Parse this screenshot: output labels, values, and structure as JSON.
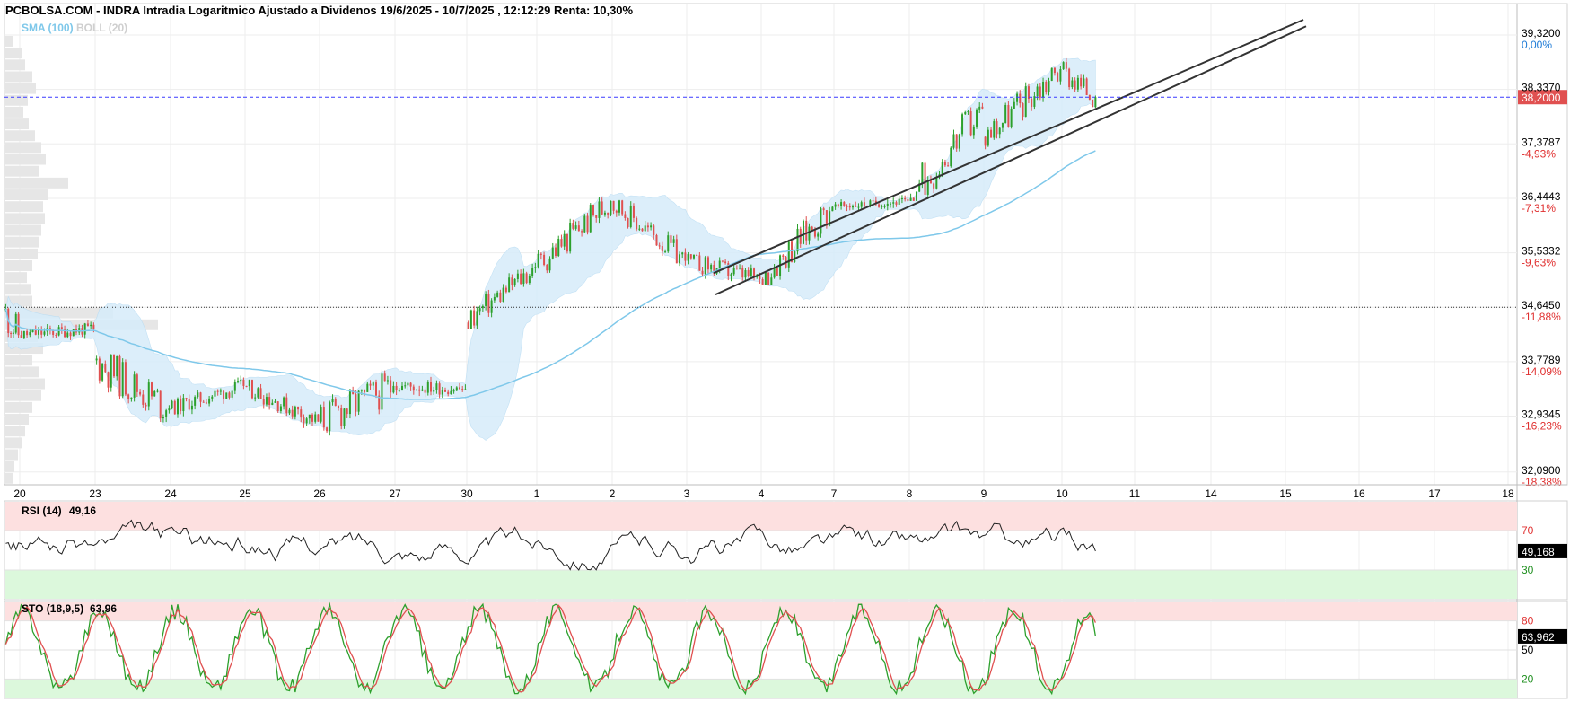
{
  "header": {
    "title": "PCBOLSA.COM - INDRA Intradia Logaritmico Ajustado a Dividenos 19/6/2025 - 10/7/2025 , 12:12:29 Renta: 10,30%",
    "sma_label": "SMA (100)",
    "boll_label": "BOLL (20)"
  },
  "colors": {
    "up": "#2ca02c",
    "down": "#e05050",
    "sma": "#7fc8ea",
    "boll_fill": "#d6ecfa",
    "trendline": "#333333",
    "price_line": "#3a3aff",
    "overbought_zone": "#fde0e0",
    "oversold_zone": "#dcf8dc",
    "rsi_line": "#222222",
    "sto_k": "#2ca02c",
    "sto_d": "#e05050",
    "pct_positive": "#1e7bd6",
    "pct_negative": "#e03030",
    "last_price_bg": "#e05050",
    "indicator_value_bg": "#000000",
    "volume_profile": "#e6e6e6"
  },
  "chart_data": [
    {
      "type": "candlestick",
      "title": "PCBOLSA.COM - INDRA Intradia Logaritmico Ajustado a Dividenos 19/6/2025 - 10/7/2025 , 12:12:29 Renta: 10,30%",
      "scale": "log",
      "ylim": [
        31.9,
        39.6
      ],
      "y_ticks": [
        {
          "value": "39,3200",
          "pct": "0,00%"
        },
        {
          "value": "38,3370",
          "pct": ""
        },
        {
          "value": "37,3787",
          "pct": "-4,93%"
        },
        {
          "value": "36,4443",
          "pct": "-7,31%"
        },
        {
          "value": "35,5332",
          "pct": "-9,63%"
        },
        {
          "value": "34,6450",
          "pct": "-11,88%"
        },
        {
          "value": "33,7789",
          "pct": "-14,09%"
        },
        {
          "value": "32,9345",
          "pct": "-16,23%"
        },
        {
          "value": "32,0900",
          "pct": "-18,38%"
        }
      ],
      "x_ticks": [
        "20",
        "23",
        "24",
        "25",
        "26",
        "27",
        "30",
        "1",
        "2",
        "3",
        "4",
        "7",
        "8",
        "9",
        "10",
        "11",
        "14",
        "15",
        "16",
        "17",
        "18"
      ],
      "last_price": "38,2000",
      "reference_level": 34.645,
      "indicators": [
        "SMA (100)",
        "BOLL (20)"
      ],
      "closes_by_session": [
        {
          "day": "19",
          "open": 34.6,
          "high": 34.7,
          "low": 33.0,
          "close": 34.2
        },
        {
          "day": "20",
          "open": 34.2,
          "high": 34.55,
          "low": 34.0,
          "close": 34.3
        },
        {
          "day": "23",
          "open": 33.8,
          "high": 33.9,
          "low": 32.15,
          "close": 33.05
        },
        {
          "day": "24",
          "open": 33.05,
          "high": 33.6,
          "low": 32.9,
          "close": 33.4
        },
        {
          "day": "25",
          "open": 33.4,
          "high": 33.5,
          "low": 32.7,
          "close": 32.85
        },
        {
          "day": "26",
          "open": 32.85,
          "high": 33.7,
          "low": 32.1,
          "close": 33.4
        },
        {
          "day": "27",
          "open": 33.4,
          "high": 33.7,
          "low": 33.1,
          "close": 33.35
        },
        {
          "day": "30",
          "open": 34.4,
          "high": 35.5,
          "low": 34.3,
          "close": 35.3
        },
        {
          "day": "1",
          "open": 35.3,
          "high": 36.7,
          "low": 35.2,
          "close": 36.4
        },
        {
          "day": "2",
          "open": 36.4,
          "high": 36.5,
          "low": 35.3,
          "close": 35.4
        },
        {
          "day": "3",
          "open": 35.4,
          "high": 35.9,
          "low": 35.0,
          "close": 35.1
        },
        {
          "day": "4",
          "open": 35.1,
          "high": 36.5,
          "low": 35.0,
          "close": 36.3
        },
        {
          "day": "7",
          "open": 36.3,
          "high": 36.5,
          "low": 36.1,
          "close": 36.4
        },
        {
          "day": "8",
          "open": 36.4,
          "high": 38.4,
          "low": 36.4,
          "close": 38.0
        },
        {
          "day": "9",
          "open": 37.5,
          "high": 38.9,
          "low": 37.2,
          "close": 38.7
        },
        {
          "day": "10",
          "open": 38.7,
          "high": 39.32,
          "low": 38.0,
          "close": 38.2
        }
      ]
    },
    {
      "type": "line",
      "name": "RSI (14)",
      "title": "RSI (14)",
      "current": "49,16",
      "last_value": "49,168",
      "ylim": [
        0,
        100
      ],
      "levels": [
        70,
        30
      ],
      "level_labels": [
        "70",
        "30"
      ]
    },
    {
      "type": "line",
      "name": "STO (18,9,5)",
      "title": "STO (18,9,5)",
      "current": "63,96",
      "last_value": "63,962",
      "ylim": [
        0,
        100
      ],
      "levels": [
        80,
        50,
        20
      ],
      "level_labels": [
        "80",
        "50",
        "20"
      ]
    }
  ]
}
